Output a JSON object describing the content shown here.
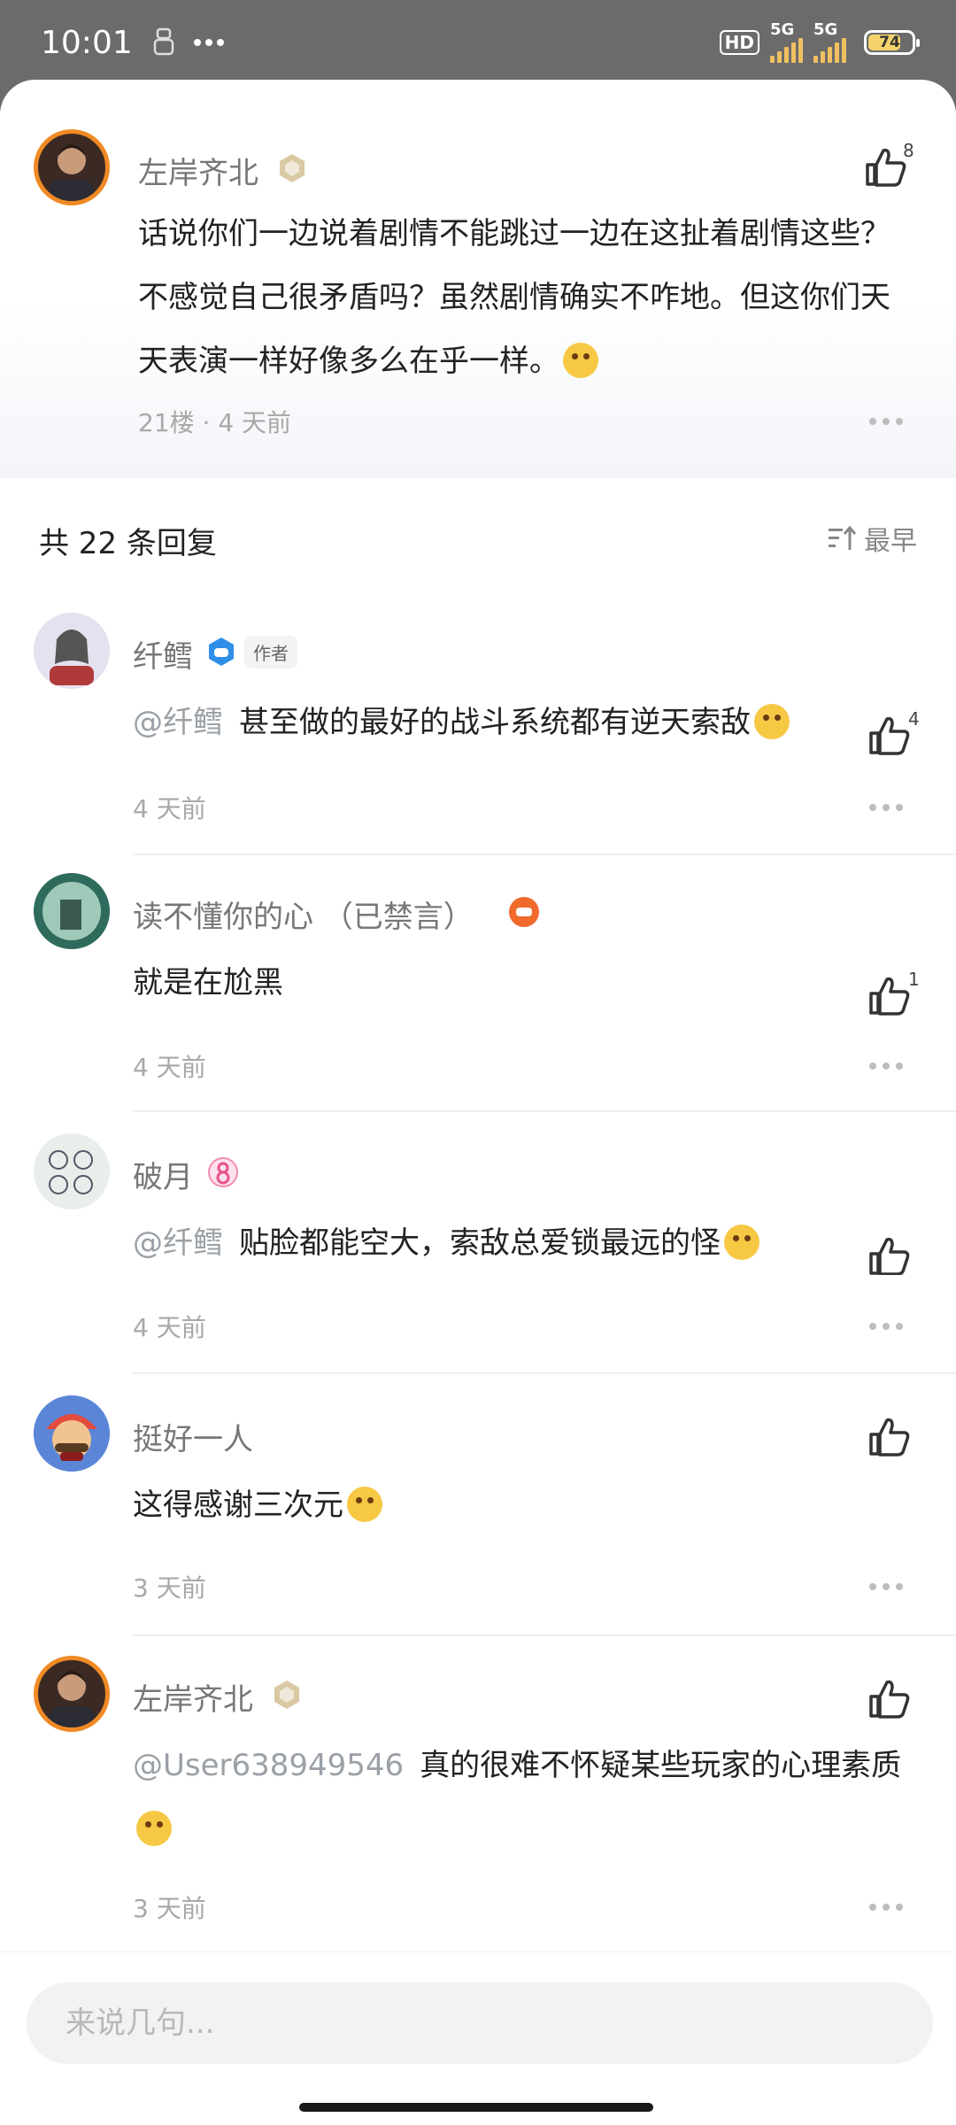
{
  "status_bar": {
    "time": "10:01",
    "hd": "HD",
    "net1": "5G",
    "net2": "5G",
    "battery": "74"
  },
  "main_comment": {
    "username": "左岸齐北",
    "likes": "8",
    "text": "话说你们一边说着剧情不能跳过一边在这扯着剧情这些？不感觉自己很矛盾吗？虽然剧情确实不咋地。但这你们天天表演一样好像多么在乎一样。",
    "meta": "21楼 · 4 天前"
  },
  "replies_header": {
    "title": "共 22 条回复",
    "sort_label": "最早"
  },
  "replies": [
    {
      "username": "纤鳕",
      "tag": "作者",
      "likes": "4",
      "mention": "@纤鳕",
      "text": "甚至做的最好的战斗系统都有逆天索敌",
      "time": "4 天前"
    },
    {
      "username": "读不懂你的心 （已禁言）",
      "likes": "1",
      "mention": "",
      "text": "就是在尬黑",
      "time": "4 天前"
    },
    {
      "username": "破月",
      "likes": "",
      "mention": "@纤鳕",
      "text": "贴脸都能空大，索敌总爱锁最远的怪",
      "time": "4 天前"
    },
    {
      "username": "挺好一人",
      "likes": "",
      "mention": "",
      "text": "这得感谢三次元",
      "time": "3 天前"
    },
    {
      "username": "左岸齐北",
      "likes": "",
      "mention": "@User638949546",
      "text": "真的很难不怀疑某些玩家的心理素质",
      "time": "3 天前"
    }
  ],
  "input": {
    "placeholder": "来说几句..."
  }
}
